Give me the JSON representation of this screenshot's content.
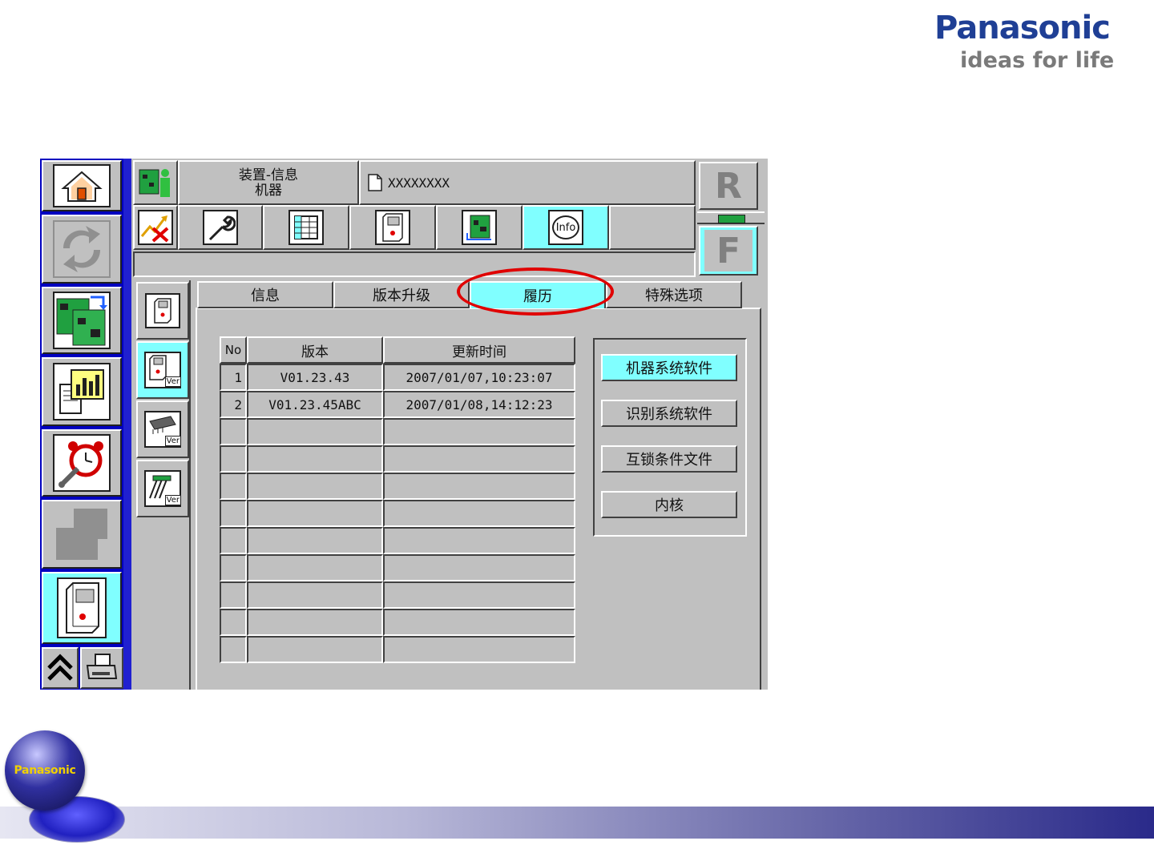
{
  "brand": {
    "logo_text": "Panasonic",
    "slogan": "ideas for life",
    "orb_text": "Panasonic"
  },
  "header": {
    "title_line1": "装置-信息",
    "title_line2": "机器",
    "file_name": "XXXXXXXX"
  },
  "side_letters": {
    "rear": "R",
    "front": "F"
  },
  "toolbar": {
    "info_label": "Info"
  },
  "tabs": [
    {
      "label": "信息",
      "active": false
    },
    {
      "label": "版本升级",
      "active": false
    },
    {
      "label": "履历",
      "active": true
    },
    {
      "label": "特殊选项",
      "active": false
    }
  ],
  "table": {
    "headers": [
      "No",
      "版本",
      "更新时间"
    ],
    "rows": [
      {
        "no": "1",
        "version": "V01.23.43",
        "time": "2007/01/07,10:23:07"
      },
      {
        "no": "2",
        "version": "V01.23.45ABC",
        "time": "2007/01/08,14:12:23"
      },
      {
        "no": "",
        "version": "",
        "time": ""
      },
      {
        "no": "",
        "version": "",
        "time": ""
      },
      {
        "no": "",
        "version": "",
        "time": ""
      },
      {
        "no": "",
        "version": "",
        "time": ""
      },
      {
        "no": "",
        "version": "",
        "time": ""
      },
      {
        "no": "",
        "version": "",
        "time": ""
      },
      {
        "no": "",
        "version": "",
        "time": ""
      },
      {
        "no": "",
        "version": "",
        "time": ""
      },
      {
        "no": "",
        "version": "",
        "time": ""
      }
    ]
  },
  "software_buttons": [
    {
      "label": "机器系统软件",
      "active": true
    },
    {
      "label": "识别系统软件",
      "active": false
    },
    {
      "label": "互锁条件文件",
      "active": false
    },
    {
      "label": "内核",
      "active": false
    }
  ],
  "version_badge": "Ver",
  "colors": {
    "panel_gray": "#c0c0c0",
    "active_cyan": "#80ffff",
    "nav_blue": "#0000c0",
    "highlight_red": "#e00000",
    "brand_blue": "#1a3a8c"
  }
}
